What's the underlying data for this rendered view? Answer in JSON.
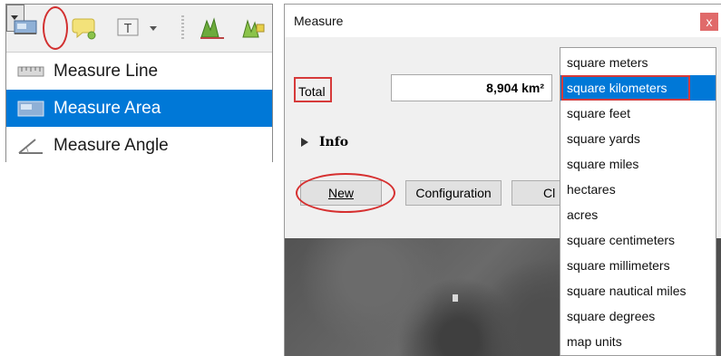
{
  "toolbar": {
    "icons": [
      "measure-area-icon",
      "dropdown-arrow-icon",
      "annotation-icon",
      "text-annotation-icon",
      "profile-tool-icon",
      "label-tool-icon"
    ]
  },
  "menu": {
    "items": [
      {
        "label": "Measure Line",
        "icon": "measure-line-icon",
        "selected": false
      },
      {
        "label": "Measure Area",
        "icon": "measure-area-icon",
        "selected": true
      },
      {
        "label": "Measure Angle",
        "icon": "measure-angle-icon",
        "selected": false
      }
    ]
  },
  "dialog": {
    "title": "Measure",
    "close_symbol": "x",
    "total_label": "Total",
    "total_value": "8,904 km²",
    "info_label": "Info",
    "buttons": {
      "new": "New",
      "configuration": "Configuration",
      "close_partial": "Cl"
    }
  },
  "units": {
    "options": [
      "square meters",
      "square kilometers",
      "square feet",
      "square yards",
      "square miles",
      "hectares",
      "acres",
      "square centimeters",
      "square millimeters",
      "square nautical miles",
      "square degrees",
      "map units"
    ],
    "selected": "square kilometers"
  },
  "colors": {
    "selection": "#0078d7",
    "annotation_red": "#d63030",
    "dialog_bg": "#f0f0f0"
  }
}
